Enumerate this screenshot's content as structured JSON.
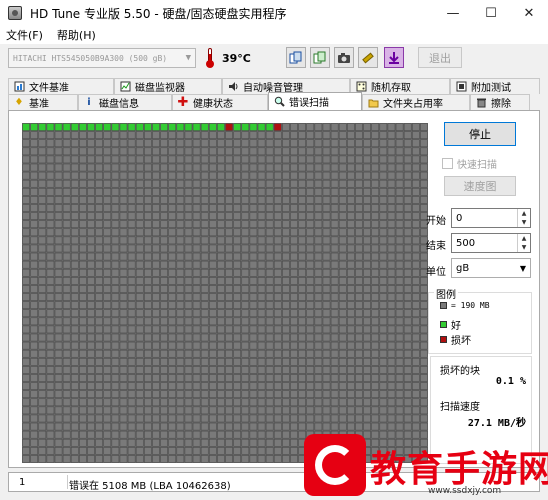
{
  "window": {
    "title": "HD Tune 专业版 5.50 - 硬盘/固态硬盘实用程序"
  },
  "menu": [
    "文件(F)",
    "帮助(H)"
  ],
  "toolbar": {
    "drive": "HITACHI HTS545050B9A300 (500 gB)",
    "temperature": "39°C",
    "exit_label": "退出"
  },
  "tabs_top": [
    {
      "label": "文件基准",
      "icon": "file-benchmark-icon"
    },
    {
      "label": "磁盘监视器",
      "icon": "disk-monitor-icon"
    },
    {
      "label": "自动噪音管理",
      "icon": "speaker-icon"
    },
    {
      "label": "随机存取",
      "icon": "random-access-icon"
    },
    {
      "label": "附加测试",
      "icon": "extra-tests-icon"
    }
  ],
  "tabs_bottom": [
    {
      "label": "基准",
      "icon": "benchmark-icon"
    },
    {
      "label": "磁盘信息",
      "icon": "info-icon"
    },
    {
      "label": "健康状态",
      "icon": "health-icon"
    },
    {
      "label": "错误扫描",
      "icon": "magnifier-icon",
      "active": true
    },
    {
      "label": "文件夹占用率",
      "icon": "folder-icon"
    },
    {
      "label": "擦除",
      "icon": "trash-icon"
    }
  ],
  "scan": {
    "stop_label": "停止",
    "quick_scan_label": "快速扫描",
    "speed_map_label": "速度图",
    "start_label": "开始",
    "start_value": "0",
    "end_label": "结束",
    "end_value": "500",
    "unit_label": "单位",
    "unit_value": "gB"
  },
  "legend": {
    "title": "图例",
    "block_size": "= 190 MB",
    "good_label": "好",
    "bad_label": "损坏",
    "colors": {
      "unscanned": "#7a7a7a",
      "good": "#33cc33",
      "bad": "#b01010",
      "grid_line": "#4a4a4a"
    }
  },
  "stats": {
    "damaged_label": "损坏的块",
    "damaged_value": "0.1 %",
    "speed_label": "扫描速度",
    "speed_value": "27.1 MB/秒"
  },
  "grid": {
    "cols": 50,
    "rows": 42,
    "scanned": 32,
    "bad_blocks": [
      25,
      31
    ]
  },
  "status": {
    "index": "1",
    "message": "错误在 5108 MB (LBA 10462638)"
  },
  "watermark": {
    "text": "教育手游网",
    "url": "www.ssdxjy.com"
  }
}
